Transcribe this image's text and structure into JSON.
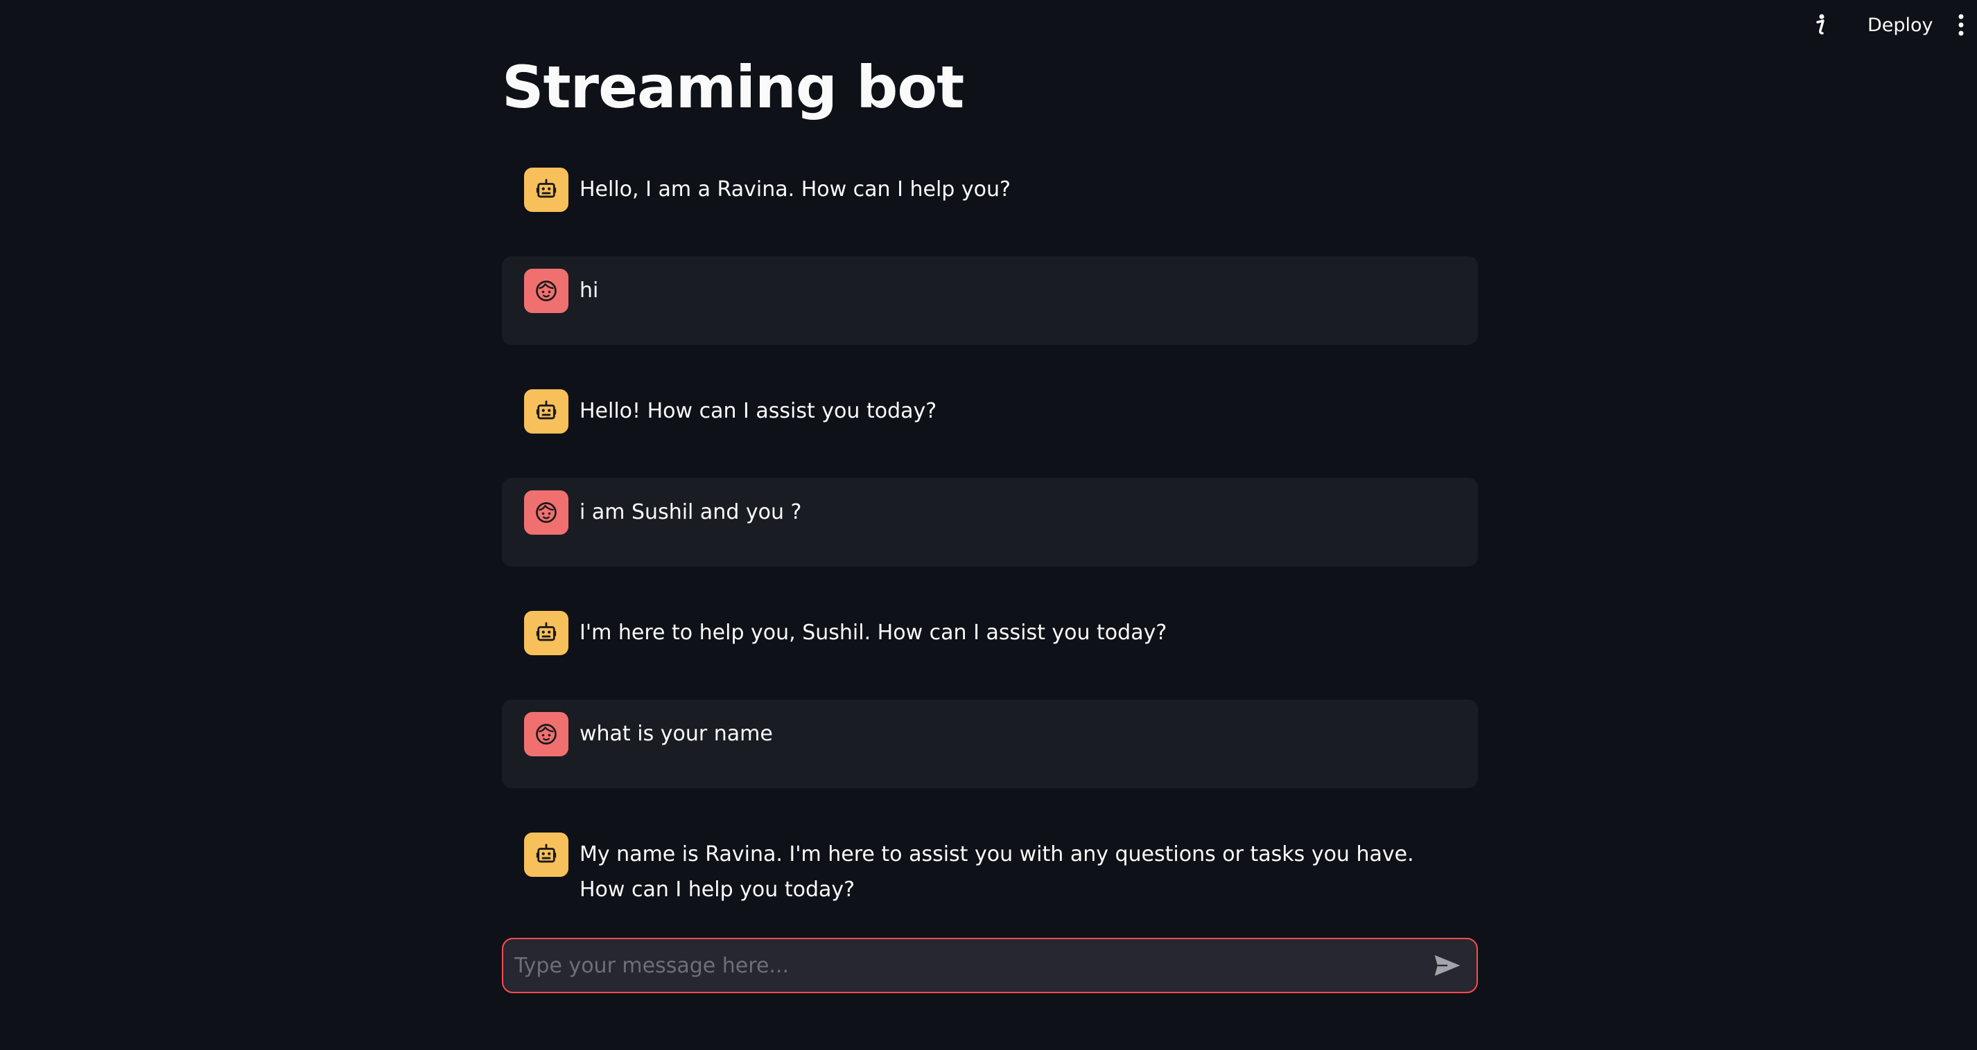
{
  "header": {
    "deploy_label": "Deploy",
    "info_icon": "running-man-icon",
    "menu_icon": "vertical-ellipsis-icon"
  },
  "page": {
    "title": "Streaming bot"
  },
  "messages": [
    {
      "role": "assistant",
      "avatar_icon": "robot-icon",
      "text": "Hello, I am a Ravina. How can I help you?"
    },
    {
      "role": "user",
      "avatar_icon": "face-icon",
      "text": "hi"
    },
    {
      "role": "assistant",
      "avatar_icon": "robot-icon",
      "text": "Hello! How can I assist you today?"
    },
    {
      "role": "user",
      "avatar_icon": "face-icon",
      "text": "i am Sushil and you ?"
    },
    {
      "role": "assistant",
      "avatar_icon": "robot-icon",
      "text": "I'm here to help you, Sushil. How can I assist you today?"
    },
    {
      "role": "user",
      "avatar_icon": "face-icon",
      "text": "what is your name"
    },
    {
      "role": "assistant",
      "avatar_icon": "robot-icon",
      "text": "My name is Ravina. I'm here to assist you with any questions or tasks you have. How can I help you today?"
    }
  ],
  "chat_input": {
    "value": "",
    "placeholder": "Type your message here...",
    "send_icon": "send-icon"
  },
  "colors": {
    "background": "#0e1117",
    "user_bubble": "#1a1c24",
    "bot_avatar": "#f7c05a",
    "user_avatar": "#f07070",
    "input_border": "#ff4b4b",
    "input_bg": "#262730"
  }
}
